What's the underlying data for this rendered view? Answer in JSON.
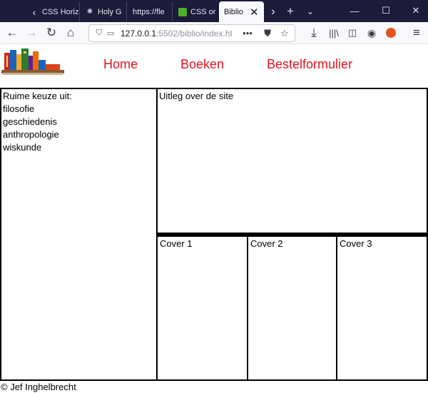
{
  "browser": {
    "tabs": [
      {
        "title": "CSS Horiz",
        "icon": "chevron-left-icon"
      },
      {
        "title": "Holy G",
        "icon": "gear-icon"
      },
      {
        "title": "https://fle",
        "icon": ""
      },
      {
        "title": "CSS or",
        "icon": "green-square-icon"
      },
      {
        "title": "Biblio",
        "icon": "",
        "active": true
      }
    ],
    "url_main": "127.0.0.1",
    "url_rest": ":5502/biblio/index.htm"
  },
  "site": {
    "nav": [
      "Home",
      "Boeken",
      "Bestelformulier"
    ],
    "aside_heading": "Ruime keuze uit:",
    "topics": [
      "filosofie",
      "geschiedenis",
      "anthropologie",
      "wiskunde"
    ],
    "intro": "Uitleg over de site",
    "covers": [
      "Cover 1",
      "Cover 2",
      "Cover 3"
    ],
    "footer": "© Jef Inghelbrecht"
  },
  "colors": {
    "tabbar_bg": "#1c1b3a",
    "link_red": "#e0141e",
    "border": "#000000"
  }
}
